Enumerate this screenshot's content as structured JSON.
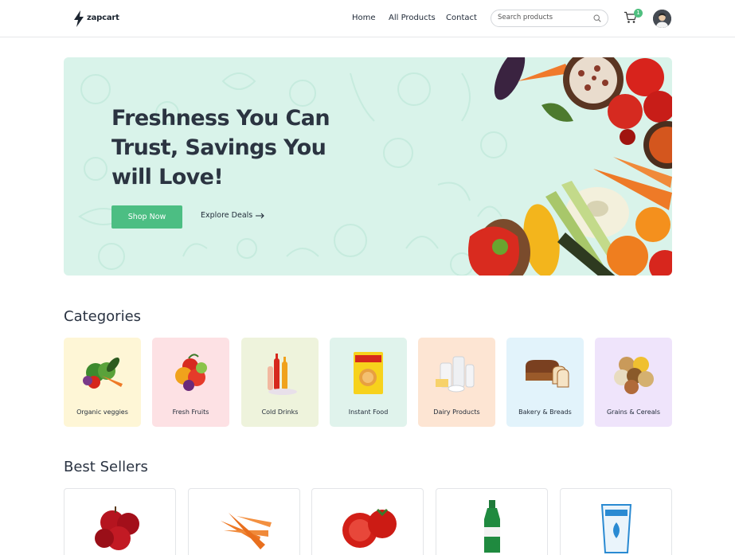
{
  "brand": {
    "name": "zapcart"
  },
  "nav": {
    "links": [
      "Home",
      "All Products",
      "Contact"
    ],
    "search_placeholder": "Search products",
    "cart_count": "1"
  },
  "hero": {
    "title": "Freshness You Can Trust, Savings You will Love!",
    "primary_button": "Shop Now",
    "secondary_link": "Explore Deals",
    "background": "#d9f3ea",
    "accent": "#4cbe83"
  },
  "categories": {
    "title": "Categories",
    "items": [
      {
        "label": "Organic veggies",
        "color": "#fef6d6",
        "icon": "veggies-icon"
      },
      {
        "label": "Fresh Fruits",
        "color": "#fde1e4",
        "icon": "fruits-icon"
      },
      {
        "label": "Cold Drinks",
        "color": "#eef3dc",
        "icon": "drinks-icon"
      },
      {
        "label": "Instant Food",
        "color": "#e0f3ec",
        "icon": "noodles-icon"
      },
      {
        "label": "Dairy Products",
        "color": "#fde5d3",
        "icon": "dairy-icon"
      },
      {
        "label": "Bakery & Breads",
        "color": "#e2f3fb",
        "icon": "bread-icon"
      },
      {
        "label": "Grains & Cereals",
        "color": "#efe4fb",
        "icon": "grains-icon"
      }
    ]
  },
  "best_sellers": {
    "title": "Best Sellers",
    "items": [
      {
        "icon": "apple-icon"
      },
      {
        "icon": "carrot-icon"
      },
      {
        "icon": "tomato-icon"
      },
      {
        "icon": "soda-bottle-icon"
      },
      {
        "icon": "milk-pack-icon"
      }
    ]
  }
}
